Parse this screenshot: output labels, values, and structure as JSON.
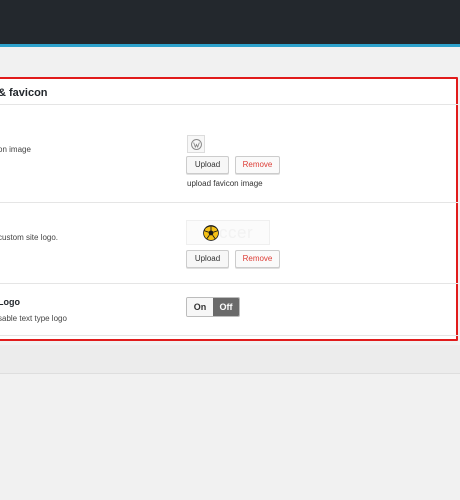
{
  "panel": {
    "title": "& favicon",
    "favicon": {
      "label": "on image",
      "upload_label": "Upload",
      "remove_label": "Remove",
      "caption": "upload favicon image",
      "icon": "wordpress-icon"
    },
    "logo": {
      "label": "custom site logo.",
      "logo_text": "ccer",
      "upload_label": "Upload",
      "remove_label": "Remove",
      "icon": "soccer-ball-icon"
    },
    "text_logo": {
      "title": "Logo",
      "label": "sable text type logo",
      "toggle_on": "On",
      "toggle_off": "Off",
      "selected": "Off"
    }
  },
  "colors": {
    "topbar": "#23282d",
    "accent": "#2ea2cc",
    "highlight_border": "#e11b1b",
    "remove_text": "#dd3d36"
  }
}
